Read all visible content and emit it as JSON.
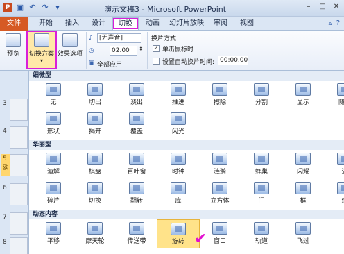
{
  "titlebar": {
    "title": "演示文稿3 - Microsoft PowerPoint",
    "app_icon": "P"
  },
  "tabs": [
    "文件",
    "开始",
    "插入",
    "设计",
    "切换",
    "动画",
    "幻灯片放映",
    "审阅",
    "视图"
  ],
  "ribbon": {
    "preview": "预览",
    "preview_group": "预览",
    "transition_scheme": "切换方案",
    "effect_options": "效果选项",
    "sound": "[无声音]",
    "duration": "02.00",
    "apply_all": "全部应用",
    "switch_mode": "换片方式",
    "on_click": "单击鼠标时",
    "after_time": "设置自动换片时间:",
    "after_value": "00:00.00"
  },
  "slides": [
    {
      "num": "3"
    },
    {
      "num": "4"
    },
    {
      "num": "5",
      "sub": "欧"
    },
    {
      "num": "6"
    },
    {
      "num": "7"
    },
    {
      "num": "8"
    }
  ],
  "gallery": {
    "sections": [
      "细微型",
      "华丽型",
      "动态内容"
    ],
    "subtle": [
      "无",
      "切出",
      "淡出",
      "推进",
      "擦除",
      "分割",
      "显示",
      "随机",
      "形状",
      "揭开",
      "覆盖",
      "闪光"
    ],
    "exciting": [
      "溶解",
      "棋盘",
      "百叶窗",
      "时钟",
      "涟漪",
      "蜂巢",
      "闪耀",
      "涡",
      "碎片",
      "切换",
      "翻转",
      "库",
      "立方体",
      "门",
      "框",
      "缩"
    ],
    "dynamic": [
      "平移",
      "摩天轮",
      "传送带",
      "旋转",
      "窗口",
      "轨道",
      "飞过"
    ]
  }
}
